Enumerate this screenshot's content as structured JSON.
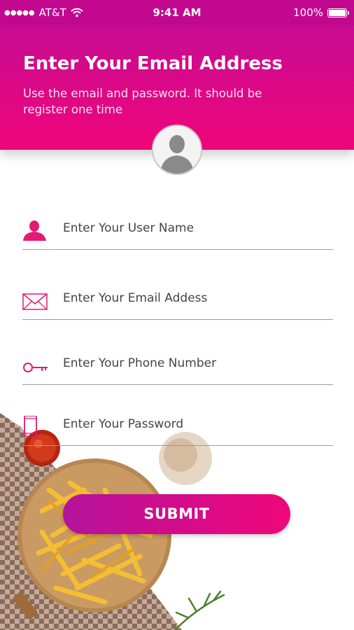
{
  "status_bar": {
    "carrier": "AT&T",
    "signal_dots": "●●●●●",
    "time": "9:41 AM",
    "battery_text": "100%",
    "battery_level": 1.0
  },
  "header": {
    "title": "Enter Your Email Address",
    "subtitle": "Use the email and password. It should be register one time"
  },
  "form": {
    "username_placeholder": "Enter Your User Name",
    "email_placeholder": "Enter Your Email Addess",
    "phone_placeholder": "Enter Your Phone Number",
    "password_placeholder": "Enter Your Password",
    "submit_label": "SUBMIT"
  },
  "colors": {
    "accent": "#ea0a7f",
    "accent_dark": "#c2088f",
    "icon": "#e21a73"
  },
  "icons": [
    "user-icon",
    "envelope-icon",
    "key-icon",
    "phone-icon",
    "avatar-icon",
    "wifi-icon",
    "battery-icon"
  ]
}
